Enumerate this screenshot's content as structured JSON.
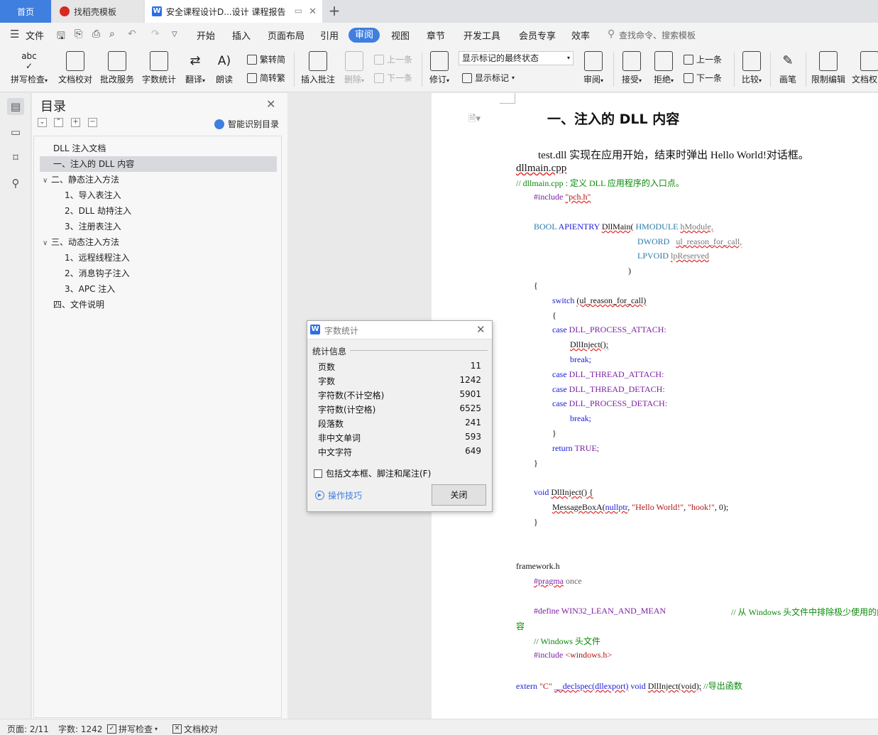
{
  "tabs": {
    "home": "首页",
    "docer": "找稻壳模板",
    "doc": "安全课程设计D...设计 课程报告"
  },
  "menu": {
    "file": "文件",
    "items": [
      "开始",
      "插入",
      "页面布局",
      "引用",
      "审阅",
      "视图",
      "章节",
      "开发工具",
      "会员专享",
      "效率"
    ],
    "active": "审阅",
    "search": "查找命令、搜索模板"
  },
  "ribbon": {
    "spell": "拼写检查",
    "proof": "文档校对",
    "batch": "批改服务",
    "wordcount": "字数统计",
    "translate": "翻译",
    "read": "朗读",
    "trad": "繁转简",
    "simp": "简转繁",
    "insert_comment": "插入批注",
    "delete": "删除",
    "prev": "上一条",
    "next": "下一条",
    "revise": "修订",
    "markup_state": "显示标记的最终状态",
    "show_markup": "显示标记",
    "review": "审阅",
    "accept": "接受",
    "reject": "拒绝",
    "prev2": "上一条",
    "next2": "下一条",
    "compare": "比较",
    "pen": "画笔",
    "restrict": "限制编辑",
    "docperm": "文档权"
  },
  "toc": {
    "title": "目录",
    "smart": "智能识别目录",
    "items": [
      {
        "text": "DLL 注入文档"
      },
      {
        "text": "一、注入的 DLL 内容"
      },
      {
        "text": "二、静态注入方法"
      },
      {
        "text": "1、导入表注入"
      },
      {
        "text": "2、DLL 劫持注入"
      },
      {
        "text": "3、注册表注入"
      },
      {
        "text": "三、动态注入方法"
      },
      {
        "text": "1、远程线程注入"
      },
      {
        "text": "2、消息钩子注入"
      },
      {
        "text": "3、APC 注入"
      },
      {
        "text": "四、文件说明"
      }
    ]
  },
  "doc": {
    "heading": "一、注入的 DLL 内容",
    "intro": "test.dll 实现在应用开始，结束时弹出 Hello World!对话框。",
    "file1": "dllmain.cpp",
    "comment1": "// dllmain.cpp : 定义 DLL 应用程序的入口点。",
    "file2": "framework.h",
    "code": {
      "inc_pch_a": "#include ",
      "inc_pch_b": "\"pch.h\"",
      "bool": "BOOL",
      "apientry": "APIENTRY",
      "dllmain": "DllMain",
      "hmodule": "HMODULE",
      "hmodule_v": "hModule,",
      "dword": "DWORD",
      "reason_v": "ul_reason_for_call,",
      "lpvoid": "LPVOID",
      "reserved_v": "lpReserved",
      "close_paren": ")",
      "open_brace": "{",
      "switch": "switch",
      "switch_arg": "(ul_reason_for_call)",
      "brace2": "{",
      "case_kw": "case",
      "c1": "DLL_PROCESS_ATTACH:",
      "dllinject_call": "DllInject();",
      "break1": "break;",
      "c2": "DLL_THREAD_ATTACH:",
      "c3": "DLL_THREAD_DETACH:",
      "c4": "DLL_PROCESS_DETACH:",
      "break2": "break;",
      "close2": "}",
      "return_kw": "return",
      "true_v": "TRUE;",
      "close1": "}",
      "void_kw": "void",
      "dllinject_def": "DllInject() {",
      "msgbox": "MessageBoxA(",
      "msgbox_args_a": "nullptr",
      "msgbox_args_b": ", ",
      "s_hello": "\"Hello World!\"",
      "s_hook": "\"hook!\"",
      "msgbox_tail": ", 0);",
      "close3": "}",
      "pragma": "#pragma",
      "once": "once",
      "define": "#define",
      "win32": "WIN32_LEAN_AND_MEAN",
      "comment_define": "// 从 Windows 头文件中排除极少使用的内",
      "comment_define2": "容",
      "comment_win": "// Windows 头文件",
      "inc_win_a": "#include ",
      "inc_win_b": "<windows.h>",
      "extern_kw": "extern",
      "extern_c": "\"C\"",
      "declspec": "__declspec(dllexport)",
      "void2": "void",
      "dllinject_decl": "DllInject(void);",
      "comment_export": "//导出函数"
    }
  },
  "dialog": {
    "title": "字数统计",
    "section": "统计信息",
    "rows": [
      {
        "label": "页数",
        "value": "11"
      },
      {
        "label": "字数",
        "value": "1242"
      },
      {
        "label": "字符数(不计空格)",
        "value": "5901"
      },
      {
        "label": "字符数(计空格)",
        "value": "6525"
      },
      {
        "label": "段落数",
        "value": "241"
      },
      {
        "label": "非中文单词",
        "value": "593"
      },
      {
        "label": "中文字符",
        "value": "649"
      }
    ],
    "checkbox": "包括文本框、脚注和尾注(F)",
    "tips": "操作技巧",
    "close": "关闭"
  },
  "status": {
    "page": "页面: 2/11",
    "words": "字数: 1242",
    "spell": "拼写检查",
    "proof": "文档校对"
  },
  "colors": {
    "accent": "#3f7fe0",
    "keyword": "#1a1ad8",
    "type": "#2b7aa9",
    "macro": "#7a1fa2",
    "comment": "#0a8a0a",
    "string": "#b01515"
  }
}
